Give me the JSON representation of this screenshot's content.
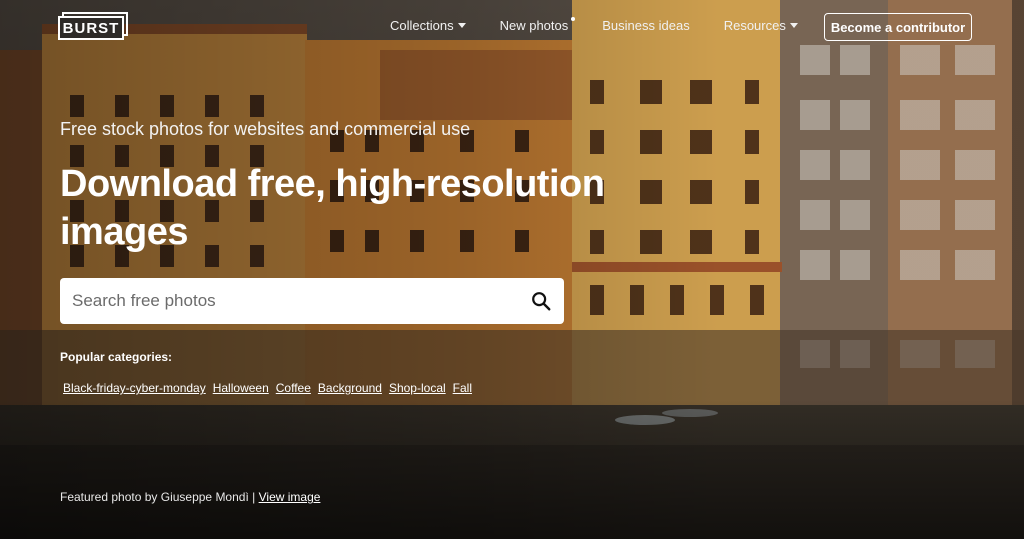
{
  "header": {
    "logo_text": "BURST",
    "nav": [
      {
        "label": "Collections",
        "has_caret": true
      },
      {
        "label": "New photos",
        "has_dot": true
      },
      {
        "label": "Business ideas"
      },
      {
        "label": "Resources",
        "has_caret": true
      }
    ],
    "cta_label": "Become a contributor"
  },
  "hero": {
    "tagline": "Free stock photos for websites and commercial use",
    "headline": "Download free, high-resolution images",
    "search": {
      "placeholder": "Search free photos",
      "value": "",
      "icon": "search-icon"
    }
  },
  "popular": {
    "label": "Popular categories:",
    "categories": [
      "Black-friday-cyber-monday",
      "Halloween",
      "Coffee",
      "Background",
      "Shop-local",
      "Fall"
    ]
  },
  "featured": {
    "prefix": "Featured photo by Giuseppe Mondì",
    "separator": "|",
    "link_label": "View image"
  },
  "colors": {
    "text": "#ffffff",
    "search_bg": "#ffffff",
    "facade_ochre": "#c98a3c",
    "facade_dark": "#2d2a27"
  }
}
